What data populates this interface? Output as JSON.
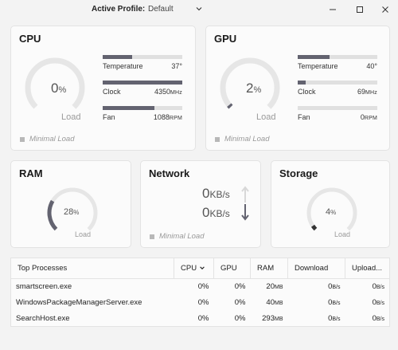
{
  "titlebar": {
    "profile_label": "Active Profile:",
    "profile_value": "Default"
  },
  "cpu": {
    "title": "CPU",
    "ring_value": "0",
    "ring_unit": "%",
    "ring_label": "Load",
    "load_percent": 0,
    "status": "Minimal Load",
    "metrics": [
      {
        "label": "Temperature",
        "value": "37°",
        "unit": "",
        "fill": 0.37
      },
      {
        "label": "Clock",
        "value": "4350",
        "unit": "MHz",
        "fill": 1.0
      },
      {
        "label": "Fan",
        "value": "1088",
        "unit": "RPM",
        "fill": 0.65
      }
    ]
  },
  "gpu": {
    "title": "GPU",
    "ring_value": "2",
    "ring_unit": "%",
    "ring_label": "Load",
    "load_percent": 2,
    "status": "Minimal Load",
    "metrics": [
      {
        "label": "Temperature",
        "value": "40°",
        "unit": "",
        "fill": 0.4
      },
      {
        "label": "Clock",
        "value": "69",
        "unit": "MHz",
        "fill": 0.1
      },
      {
        "label": "Fan",
        "value": "0",
        "unit": "RPM",
        "fill": 0
      }
    ]
  },
  "ram": {
    "title": "RAM",
    "ring_value": "28",
    "ring_unit": "%",
    "ring_label": "Load",
    "load_percent": 28
  },
  "network": {
    "title": "Network",
    "upload_value": "0",
    "download_value": "0",
    "unit": "KB/s",
    "status": "Minimal Load"
  },
  "storage": {
    "title": "Storage",
    "ring_value": "4",
    "ring_unit": "%",
    "ring_label": "Load",
    "load_percent": 4
  },
  "processes": {
    "columns": [
      "Top Processes",
      "CPU",
      "GPU",
      "RAM",
      "Download",
      "Upload..."
    ],
    "rows": [
      {
        "name": "smartscreen.exe",
        "cpu": "0%",
        "gpu": "0%",
        "ram": "20",
        "ram_unit": "MB",
        "download": "0",
        "download_unit": "B/s",
        "upload": "0",
        "upload_unit": "B/s"
      },
      {
        "name": "WindowsPackageManagerServer.exe",
        "cpu": "0%",
        "gpu": "0%",
        "ram": "40",
        "ram_unit": "MB",
        "download": "0",
        "download_unit": "B/s",
        "upload": "0",
        "upload_unit": "B/s"
      },
      {
        "name": "SearchHost.exe",
        "cpu": "0%",
        "gpu": "0%",
        "ram": "293",
        "ram_unit": "MB",
        "download": "0",
        "download_unit": "B/s",
        "upload": "0",
        "upload_unit": "B/s"
      }
    ]
  },
  "colors": {
    "accent": "#636370",
    "track": "#e6e6e6",
    "muted": "#9a9a9a"
  }
}
